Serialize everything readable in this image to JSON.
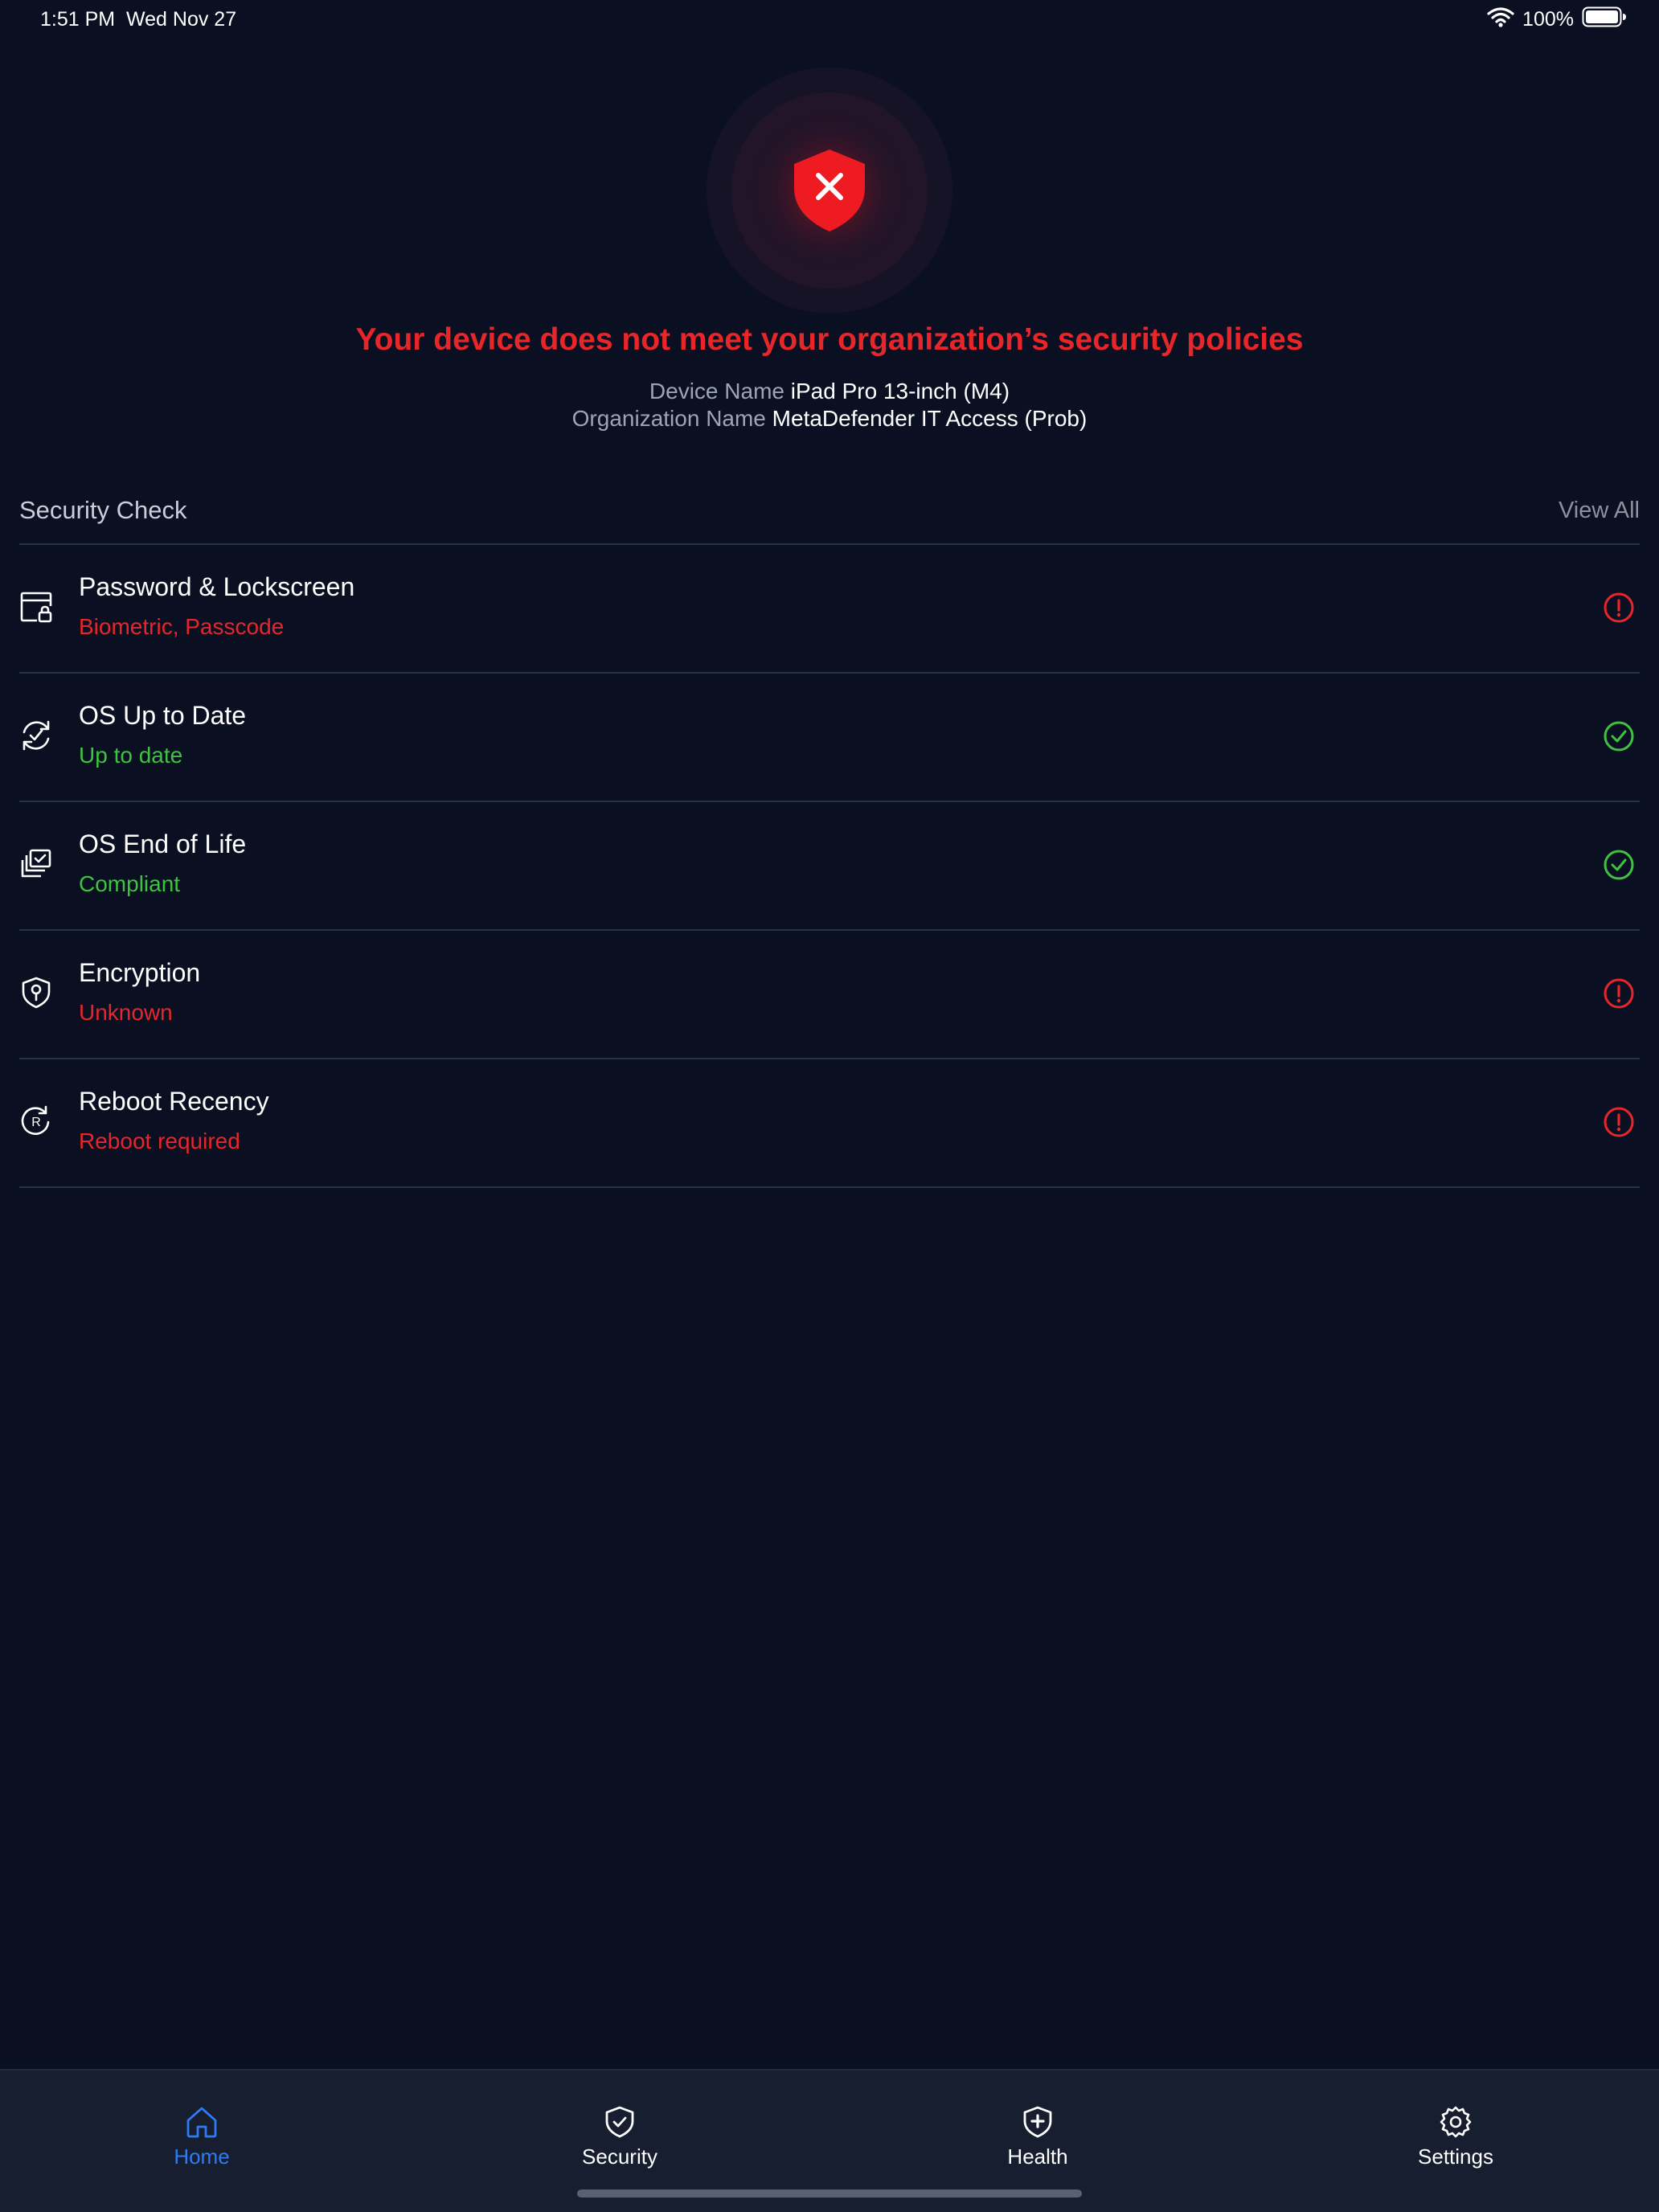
{
  "status_bar": {
    "time": "1:51 PM",
    "date": "Wed Nov 27",
    "battery": "100%",
    "icons": [
      "wifi-icon",
      "battery-icon"
    ]
  },
  "hero": {
    "icon": "shield-x-icon",
    "title": "Your device does not meet your organization’s security policies",
    "device_label": "Device Name",
    "device_value": "iPad Pro 13-inch (M4)",
    "org_label": "Organization Name",
    "org_value": "MetaDefender IT Access (Prob)"
  },
  "security_check": {
    "title": "Security Check",
    "view_all": "View All",
    "items": [
      {
        "title": "Password & Lockscreen",
        "subtitle": "Biometric, Passcode",
        "status": "fail",
        "icon": "lockscreen-icon"
      },
      {
        "title": "OS Up to Date",
        "subtitle": "Up to date",
        "status": "pass",
        "icon": "refresh-check-icon"
      },
      {
        "title": "OS End of Life",
        "subtitle": "Compliant",
        "status": "pass",
        "icon": "stacked-check-icon"
      },
      {
        "title": "Encryption",
        "subtitle": "Unknown",
        "status": "fail",
        "icon": "shield-key-icon"
      },
      {
        "title": "Reboot Recency",
        "subtitle": "Reboot required",
        "status": "fail",
        "icon": "reboot-icon"
      }
    ]
  },
  "tab_bar": {
    "tabs": [
      {
        "label": "Home",
        "icon": "home-icon",
        "active": true
      },
      {
        "label": "Security",
        "icon": "shield-check-icon",
        "active": false
      },
      {
        "label": "Health",
        "icon": "shield-plus-icon",
        "active": false
      },
      {
        "label": "Settings",
        "icon": "gear-icon",
        "active": false
      }
    ]
  },
  "colors": {
    "background": "#0a1022",
    "danger": "#e8262a",
    "success": "#3fc23f",
    "accent": "#2f7bf2",
    "tab_bar": "#161e30"
  }
}
